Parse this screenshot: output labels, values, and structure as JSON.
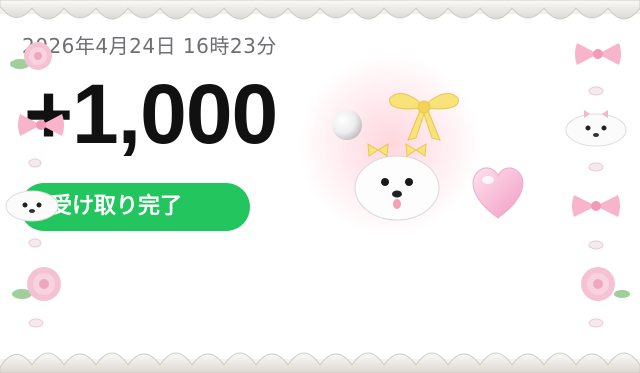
{
  "datetime": "2026年4月24日 16時23分",
  "amount": "+1,000",
  "status_button": {
    "label": "受け取り完了"
  },
  "colors": {
    "accent_green": "#22c55e",
    "amount_text": "#111111",
    "date_text": "#6e6e73",
    "ribbon_pink": "#f7a8c4",
    "ribbon_yellow": "#f8e27a",
    "heart_pink": "#f4a9c9"
  },
  "decorations": {
    "frame_icons": [
      "cream-frill",
      "pink-ribbon-icon",
      "pink-rose-icon",
      "pearl-icon",
      "puppy-icon"
    ],
    "sticker_icons": [
      "pearl-icon",
      "yellow-ribbon-icon",
      "puppy-with-bows-icon",
      "pink-heart-icon"
    ]
  }
}
